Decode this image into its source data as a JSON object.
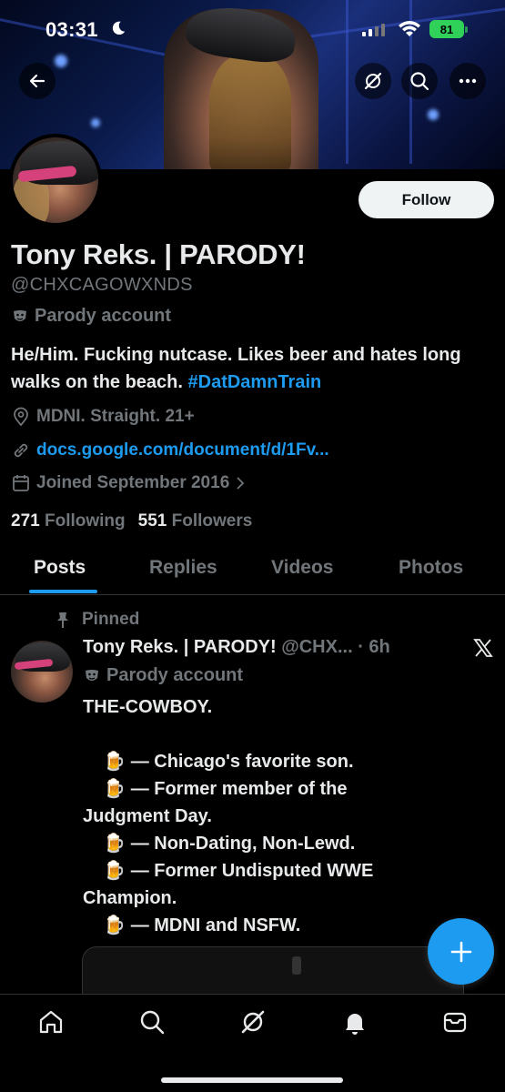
{
  "status_bar": {
    "time": "03:31",
    "battery": "81"
  },
  "profile": {
    "name": "Tony Reks. | PARODY!",
    "handle": "@CHXCAGOWXNDS",
    "parody_label": "Parody account",
    "bio_text": "He/Him. Fucking nutcase. Likes beer and hates long walks on the beach. ",
    "bio_hashtag": "#DatDamnTrain",
    "location": "MDNI. Straight. 21+",
    "website": "docs.google.com/document/d/1Fv...",
    "joined": "Joined September 2016",
    "following_count": "271",
    "following_label": "Following",
    "followers_count": "551",
    "followers_label": "Followers",
    "follow_button": "Follow"
  },
  "tabs": [
    {
      "label": "Posts"
    },
    {
      "label": "Replies"
    },
    {
      "label": "Videos"
    },
    {
      "label": "Photos"
    }
  ],
  "pinned_post": {
    "pinned_label": "Pinned",
    "author_name": "Tony Reks. | PARODY!",
    "author_handle": "@CHX...",
    "time": "· 6h",
    "parody_label": "Parody account",
    "lines": [
      "THE-COWBOY.",
      "",
      "    🍺 — Chicago's favorite son.",
      "    🍺 — Former member of the Judgment Day.",
      "    🍺 — Non-Dating, Non-Lewd.",
      "    🍺 — Former Undisputed WWE Champion.",
      "    🍺 — MDNI and NSFW."
    ]
  },
  "colors": {
    "accent": "#1d9bf0",
    "background": "#000000",
    "muted": "#71767b",
    "text": "#e7e9ea"
  },
  "icons": [
    "back-arrow-icon",
    "grok-icon",
    "search-icon",
    "more-icon",
    "location-icon",
    "link-icon",
    "calendar-icon",
    "pin-icon",
    "x-logo-icon",
    "plus-icon",
    "home-icon",
    "nav-search-icon",
    "nav-grok-icon",
    "bell-icon",
    "mail-icon"
  ]
}
